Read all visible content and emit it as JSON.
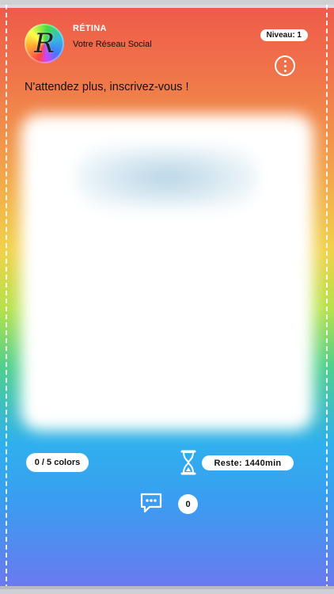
{
  "header": {
    "avatar_letter": "R",
    "brand": "RÉTINA",
    "tagline": "Votre Réseau Social",
    "level": "Niveau: 1"
  },
  "post": {
    "headline": "N'attendez plus, inscrivez-vous !"
  },
  "stats": {
    "colors": "0 / 5 colors",
    "remaining": "Reste: 1440min",
    "comments": "0"
  },
  "icons": {
    "menu": "more-vertical-icon",
    "timer": "hourglass-icon",
    "comment": "chat-bubble-icon"
  }
}
